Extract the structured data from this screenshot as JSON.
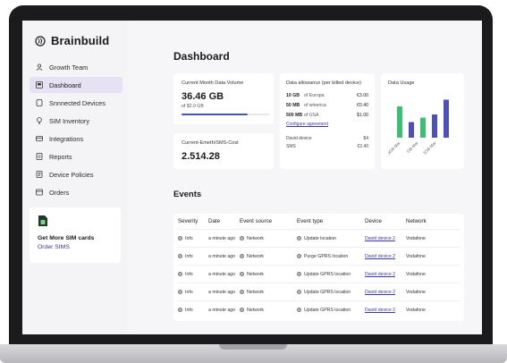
{
  "brand": {
    "name": "Brainbuild"
  },
  "sidebar": {
    "items": [
      {
        "label": "Growth Team",
        "icon": "user-icon",
        "active": false
      },
      {
        "label": "Dashboard",
        "icon": "dashboard-icon",
        "active": true
      },
      {
        "label": "Snnnected Devices",
        "icon": "device-icon",
        "active": false
      },
      {
        "label": "SIM Inventory",
        "icon": "bulb-icon",
        "active": false
      },
      {
        "label": "Integrations",
        "icon": "integration-icon",
        "active": false
      },
      {
        "label": "Reports",
        "icon": "report-icon",
        "active": false
      },
      {
        "label": "Device Policies",
        "icon": "policy-icon",
        "active": false
      },
      {
        "label": "Orders",
        "icon": "orders-icon",
        "active": false
      }
    ],
    "sim_card": {
      "title": "Get More SIM cards",
      "link": "Order SIMS"
    }
  },
  "page_title": "Dashboard",
  "volume_card": {
    "label": "Current Month Data Volume",
    "value": "36.46 GB",
    "sub": "of $2.0 GB",
    "progress": 0.75
  },
  "cost_card": {
    "label": "Current-Emeth/SMS-Cost",
    "value": "2.514.28"
  },
  "allowance_card": {
    "label": "Data allowance (per billed device)",
    "rows": [
      {
        "amount": "10 GB",
        "region": "of Europa",
        "price": "€3.00"
      },
      {
        "amount": "50 MB",
        "region": "of winerica",
        "price": "€0.40"
      },
      {
        "amount": "500 MB",
        "region": "of USA",
        "price": "$1.00"
      }
    ],
    "configure_link": "Configure agreement",
    "devices": [
      {
        "label": "David device",
        "value": "$4"
      },
      {
        "label": "SMS",
        "value": "€2.40"
      }
    ]
  },
  "usage_card": {
    "label": "Data Usage",
    "ticks": [
      "5GB Mar",
      "GB Mar",
      "1GB Mar"
    ]
  },
  "chart_data": {
    "type": "bar",
    "values": [
      70,
      35,
      45,
      52,
      85
    ],
    "colors": [
      "#3fbf74",
      "#4b4fbf",
      "#3fbf74",
      "#4b4fbf",
      "#4b4fbf"
    ],
    "ylim": [
      0,
      100
    ]
  },
  "events": {
    "title": "Events",
    "columns": [
      "Severity",
      "Date",
      "Event source",
      "Event type",
      "Device",
      "Network"
    ],
    "rows": [
      {
        "severity": "Info",
        "date": "a minute ago",
        "source": "Network",
        "type": "Update location",
        "device": "David device 2",
        "network": "Vodafone"
      },
      {
        "severity": "Info",
        "date": "a minute ago",
        "source": "Network",
        "type": "Purge GPRS location",
        "device": "David device 2",
        "network": "Vodafone"
      },
      {
        "severity": "Info",
        "date": "a minute ago",
        "source": "Network",
        "type": "Update GPRS location",
        "device": "David device 2",
        "network": "Vodafone"
      },
      {
        "severity": "Info",
        "date": "a minute ago",
        "source": "Network",
        "type": "Update GPRS location",
        "device": "David device 2",
        "network": "Vodafone"
      },
      {
        "severity": "Info",
        "date": "a minute ago",
        "source": "Network",
        "type": "Update GPRS location",
        "device": "David device 2",
        "network": "Vodafone"
      }
    ]
  }
}
